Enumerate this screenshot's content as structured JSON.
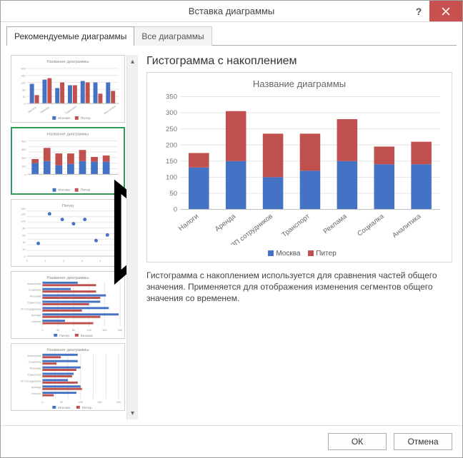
{
  "dialog": {
    "title": "Вставка диаграммы",
    "help_tip": "?",
    "close_tip": "×"
  },
  "tabs": {
    "recommended": "Рекомендуемые диаграммы",
    "all": "Все диаграммы"
  },
  "preview": {
    "heading": "Гистограмма с накоплением",
    "description": "Гистограмма с накоплением используется для сравнения частей общего значения. Применяется для отображения изменения сегментов общего значения со временем."
  },
  "buttons": {
    "ok": "ОК",
    "cancel": "Отмена"
  },
  "legend": {
    "series1": "Москва",
    "series2": "Питер"
  },
  "colors": {
    "series1": "#4472c4",
    "series2": "#c0504d",
    "axis": "#bfbfbf",
    "grid": "#e6e6e6",
    "thumb_title": "#8a8a8a"
  },
  "chart_data": {
    "type": "bar",
    "stacked": true,
    "title": "Название диаграммы",
    "xlabel": "",
    "ylabel": "",
    "ylim": [
      0,
      350
    ],
    "yticks": [
      0,
      50,
      100,
      150,
      200,
      250,
      300,
      350
    ],
    "categories": [
      "Налоги",
      "Аренда",
      "ЗП сотрудников",
      "Транспорт",
      "Реклама",
      "Социалка",
      "Аналитика"
    ],
    "series": [
      {
        "name": "Москва",
        "values": [
          130,
          150,
          100,
          120,
          150,
          140,
          140
        ]
      },
      {
        "name": "Питер",
        "values": [
          45,
          155,
          135,
          115,
          130,
          55,
          70
        ]
      }
    ],
    "legend_position": "bottom"
  },
  "thumbnails": [
    {
      "kind": "clustered_column",
      "title": "Название диаграммы",
      "legend": [
        "Москва",
        "Питер"
      ]
    },
    {
      "kind": "stacked_column",
      "title": "Название диаграммы",
      "legend": [
        "Москва",
        "Питер"
      ],
      "selected": true
    },
    {
      "kind": "scatter",
      "title": "Питер"
    },
    {
      "kind": "clustered_bar",
      "title": "Название диаграммы",
      "legend": [
        "Питер",
        "Москва"
      ]
    },
    {
      "kind": "clustered_bar",
      "title": "Название диаграммы",
      "legend": [
        "Москва",
        "Питер"
      ]
    }
  ]
}
